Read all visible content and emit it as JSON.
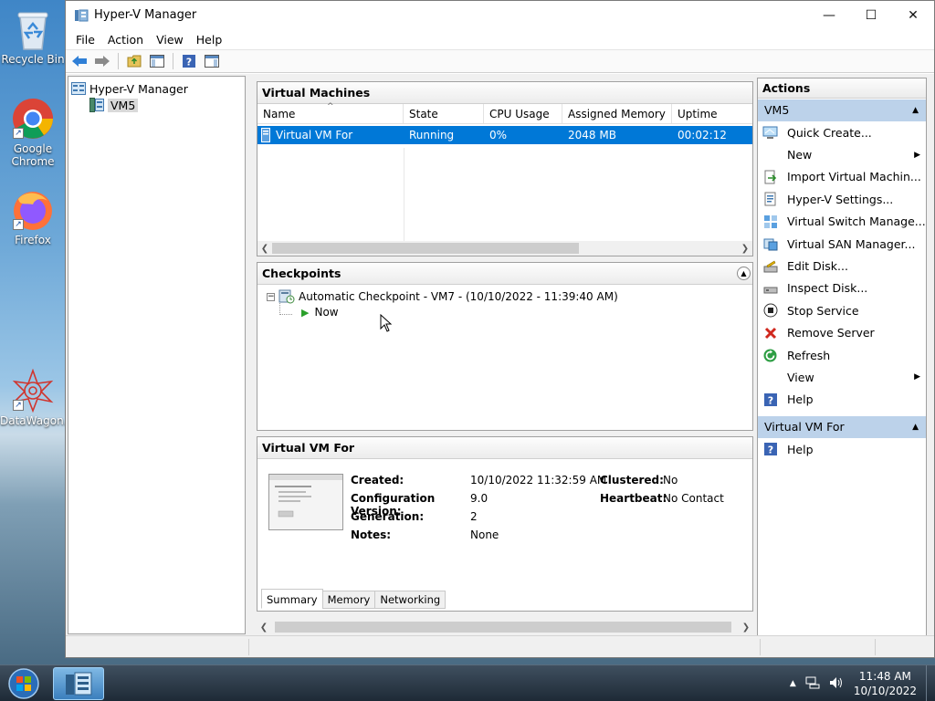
{
  "desktop": {
    "icons": [
      {
        "label": "Recycle Bin"
      },
      {
        "label": "Google Chrome"
      },
      {
        "label": "Firefox"
      },
      {
        "label": "DataWagon..."
      }
    ]
  },
  "window": {
    "title": "Hyper-V Manager",
    "controls": {
      "minimize": "—",
      "maximize": "☐",
      "close": "✕"
    }
  },
  "menu": [
    "File",
    "Action",
    "View",
    "Help"
  ],
  "tree": {
    "root": "Hyper-V Manager",
    "child": "VM5"
  },
  "vms": {
    "title": "Virtual Machines",
    "columns": [
      "Name",
      "State",
      "CPU Usage",
      "Assigned Memory",
      "Uptime"
    ],
    "rows": [
      {
        "name": "Virtual VM For",
        "state": "Running",
        "cpu": "0%",
        "memory": "2048 MB",
        "uptime": "00:02:12"
      }
    ]
  },
  "checkpoints": {
    "title": "Checkpoints",
    "items": [
      {
        "label": "Automatic Checkpoint - VM7 - (10/10/2022 - 11:39:40 AM)"
      },
      {
        "label": "Now"
      }
    ]
  },
  "details": {
    "title": "Virtual VM For",
    "fields": [
      {
        "label": "Created:",
        "value": "10/10/2022 11:32:59 AM"
      },
      {
        "label": "Configuration Version:",
        "value": "9.0"
      },
      {
        "label": "Generation:",
        "value": "2"
      },
      {
        "label": "Notes:",
        "value": "None"
      }
    ],
    "fields_right": [
      {
        "label": "Clustered:",
        "value": "No"
      },
      {
        "label": "Heartbeat:",
        "value": "No Contact"
      }
    ],
    "tabs": [
      "Summary",
      "Memory",
      "Networking"
    ]
  },
  "actions": {
    "title": "Actions",
    "section1": "VM5",
    "items": [
      {
        "label": "Quick Create...",
        "icon": "quick-create-icon"
      },
      {
        "label": "New",
        "icon": "none",
        "submenu": true
      },
      {
        "label": "Import Virtual Machin...",
        "icon": "import-icon"
      },
      {
        "label": "Hyper-V Settings...",
        "icon": "settings-icon"
      },
      {
        "label": "Virtual Switch Manage...",
        "icon": "switch-icon"
      },
      {
        "label": "Virtual SAN Manager...",
        "icon": "san-icon"
      },
      {
        "label": "Edit Disk...",
        "icon": "edit-disk-icon"
      },
      {
        "label": "Inspect Disk...",
        "icon": "inspect-disk-icon"
      },
      {
        "label": "Stop Service",
        "icon": "stop-icon"
      },
      {
        "label": "Remove Server",
        "icon": "remove-icon"
      },
      {
        "label": "Refresh",
        "icon": "refresh-icon"
      },
      {
        "label": "View",
        "icon": "none",
        "submenu": true
      },
      {
        "label": "Help",
        "icon": "help-icon"
      }
    ],
    "section2": "Virtual VM For",
    "items2": [
      {
        "label": "Help",
        "icon": "help-icon"
      }
    ]
  },
  "taskbar": {
    "time": "11:48 AM",
    "date": "10/10/2022"
  },
  "colors": {
    "selection": "#0078d7",
    "section": "#bcd2ea"
  }
}
